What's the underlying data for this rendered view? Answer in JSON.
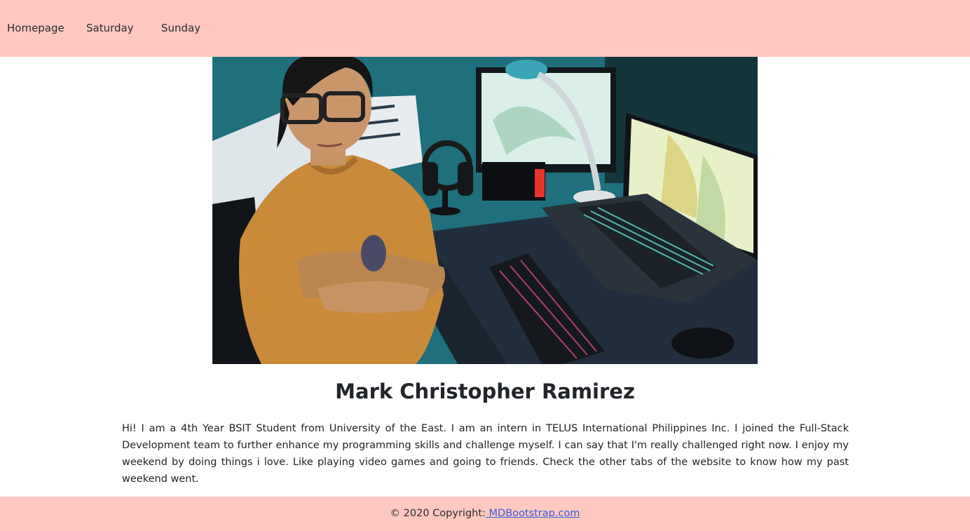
{
  "nav": {
    "items": [
      {
        "label": "Homepage"
      },
      {
        "label": "Saturday"
      },
      {
        "label": "Sunday"
      }
    ]
  },
  "profile": {
    "name": "Mark Christopher Ramirez",
    "bio": "Hi! I am a 4th Year BSIT Student from University of the East. I am an intern in TELUS International Philippines Inc. I joined the Full-Stack Development team to further enhance my programming skills and challenge myself. I can say that I'm really challenged right now. I enjoy my weekend by doing things i love. Like playing video games and going to friends. Check the other tabs of the website to know how my past weekend went."
  },
  "footer": {
    "copyright": "© 2020 Copyright:",
    "link_label": " MDBootstrap.com"
  },
  "colors": {
    "navbar_bg": "#ffc8c0",
    "footer_bg": "#ffc8c0",
    "link": "#3b5bdb"
  }
}
